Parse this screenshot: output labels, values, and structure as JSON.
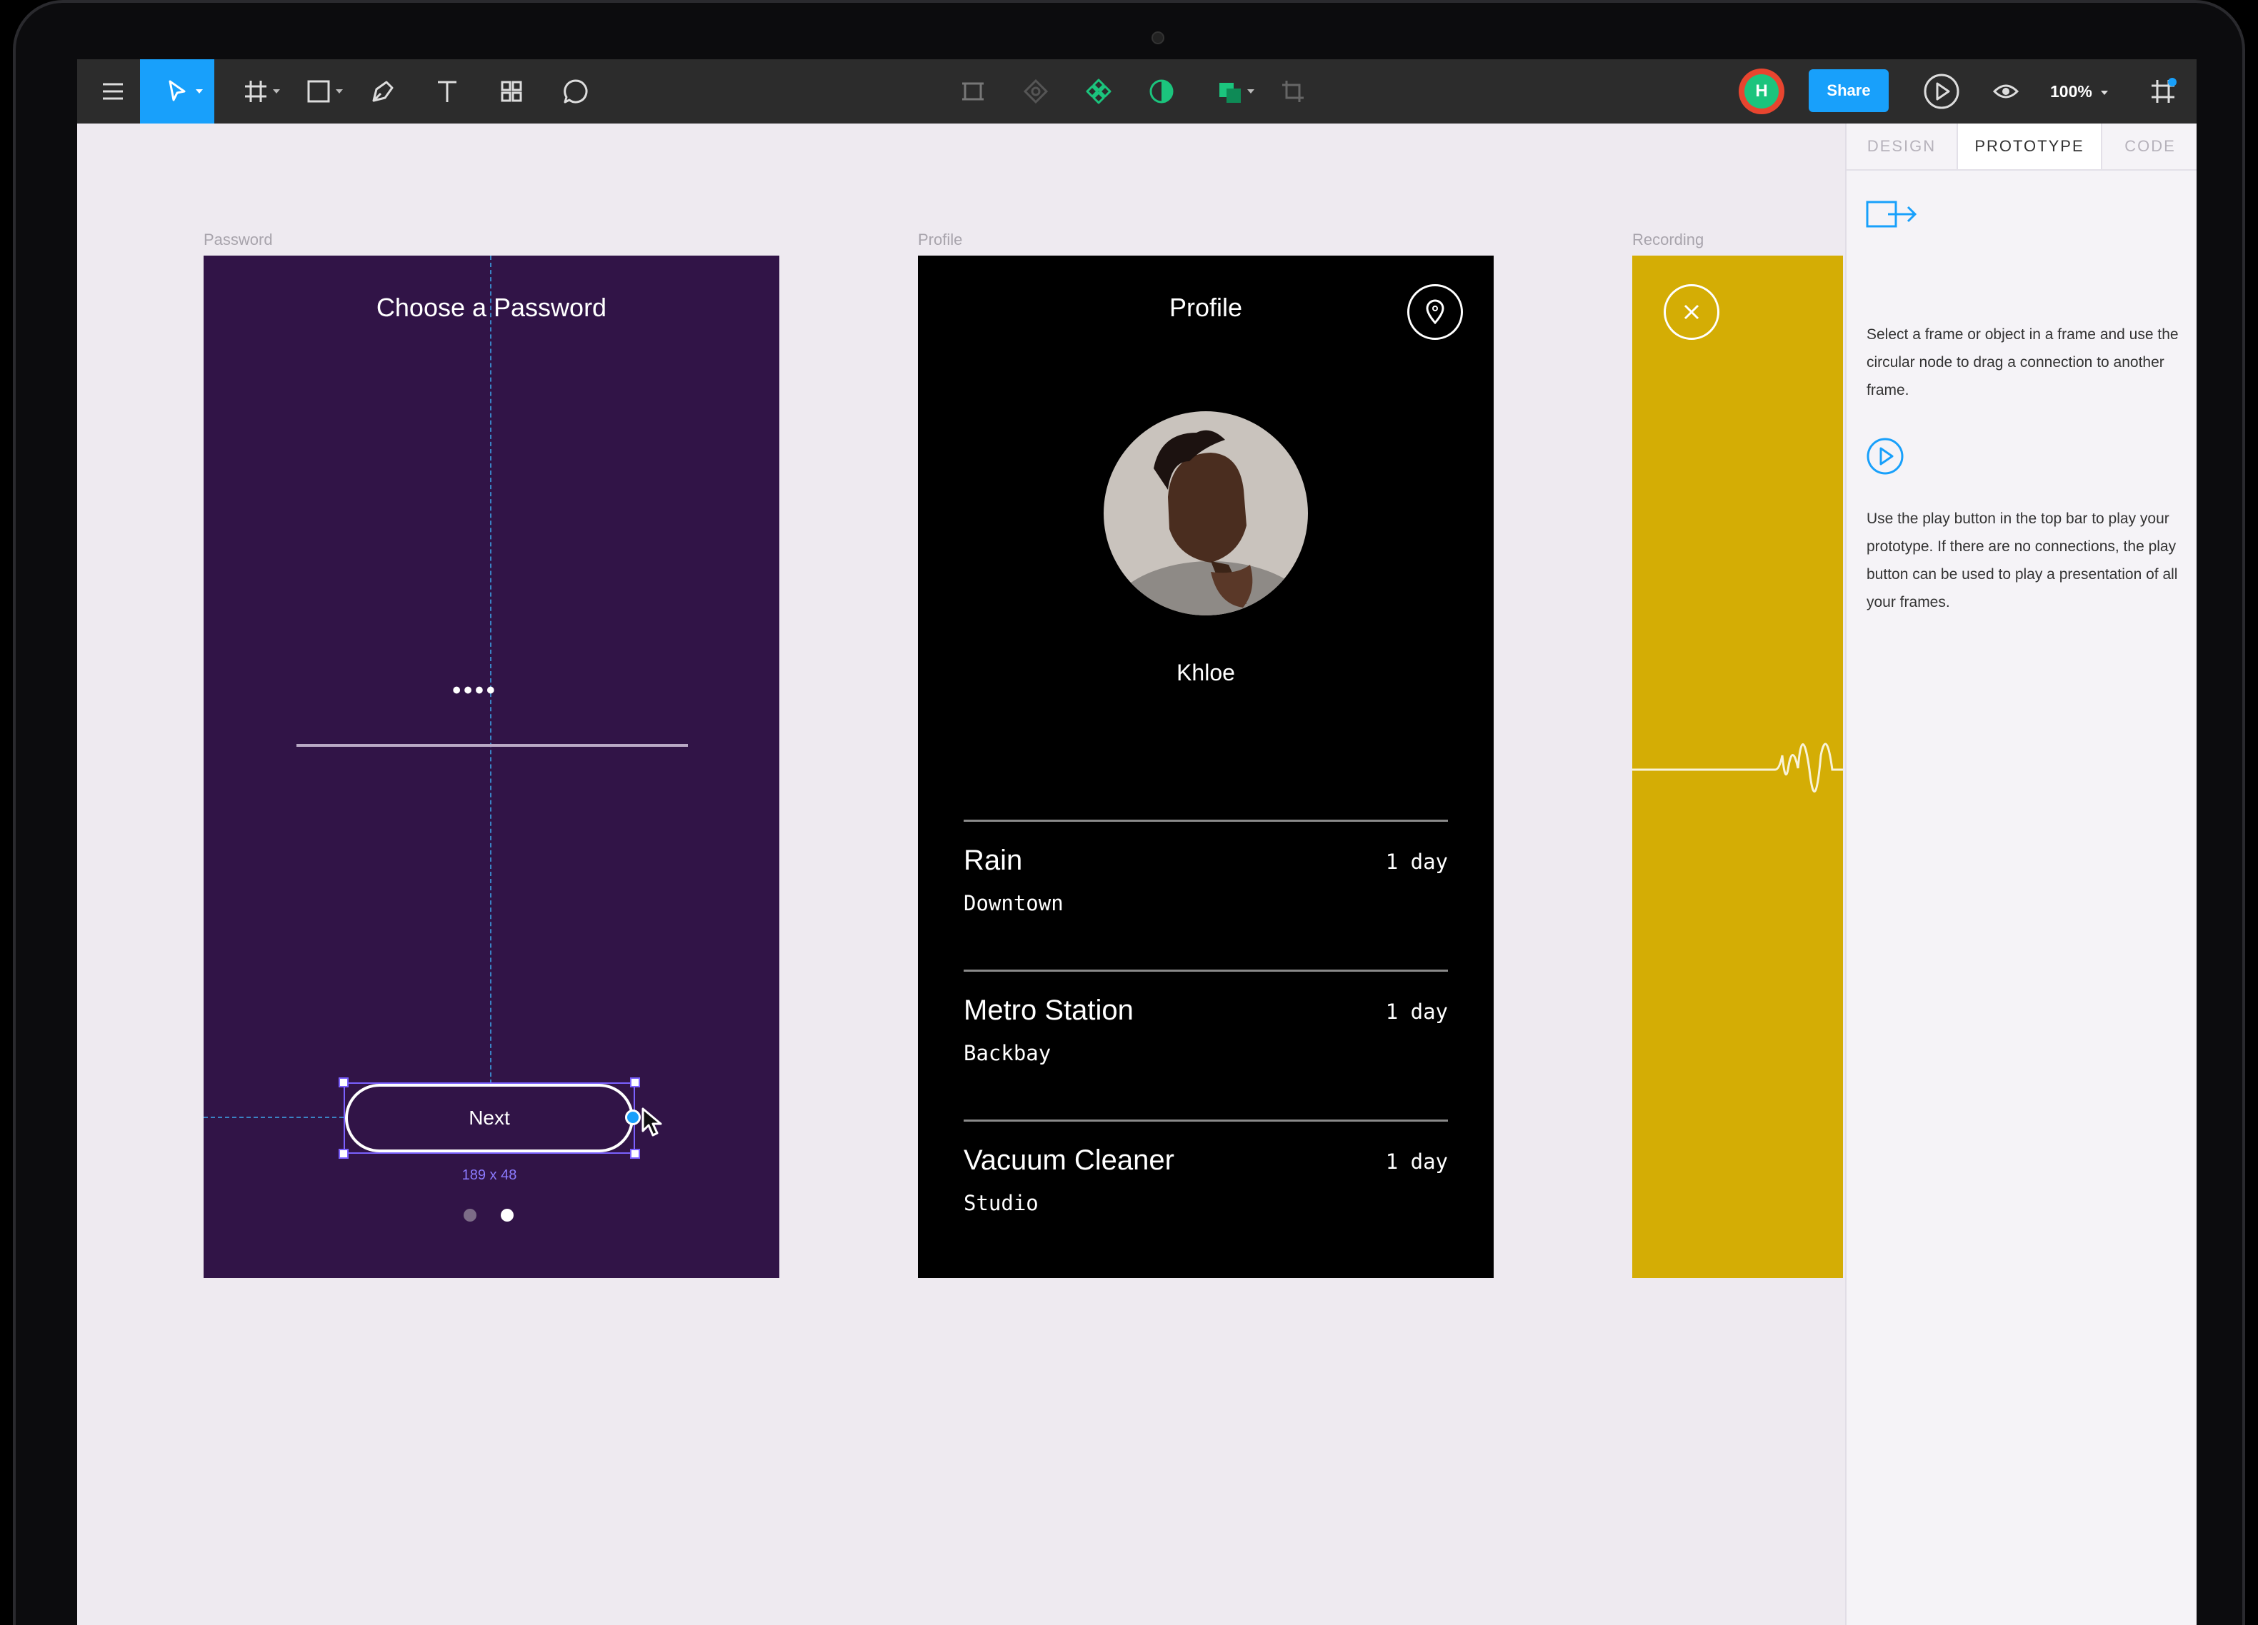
{
  "toolbar": {
    "tools": [
      "menu-icon",
      "move-icon",
      "frame-icon",
      "shape-icon",
      "pen-icon",
      "text-icon",
      "components-icon",
      "comment-icon"
    ],
    "center_tools": [
      "create-component-icon",
      "boolean-icon",
      "component-icon",
      "mask-icon",
      "fill-icon",
      "crop-icon"
    ],
    "avatar_initial": "H",
    "share_label": "Share",
    "zoom": "100%"
  },
  "canvas": {
    "frames": [
      {
        "label": "Password",
        "title": "Choose a Password",
        "password_dots": "••••",
        "next_label": "Next",
        "size_readout": "189 x 48",
        "accent": "#311447"
      },
      {
        "label": "Profile",
        "title": "Profile",
        "name": "Khloe",
        "items": [
          {
            "title": "Rain",
            "subtitle": "Downtown",
            "time": "1 day"
          },
          {
            "title": "Metro Station",
            "subtitle": "Backbay",
            "time": "1 day"
          },
          {
            "title": "Vacuum Cleaner",
            "subtitle": "Studio",
            "time": "1 day"
          }
        ]
      },
      {
        "label": "Recording",
        "accent": "#d4ad05"
      }
    ]
  },
  "panel": {
    "tabs": [
      "DESIGN",
      "PROTOTYPE",
      "CODE"
    ],
    "active_tab": "PROTOTYPE",
    "tip1": "Select a frame or object in a frame and use the circular node to drag a connection to another frame.",
    "tip2": "Use the play button in the top bar to play your prototype. If there are no connections, the play button can be used to play a presentation of all your frames."
  },
  "colors": {
    "toolbar": "#2c2c2c",
    "accent_blue": "#18a0fb",
    "selection": "#7b61ff"
  }
}
